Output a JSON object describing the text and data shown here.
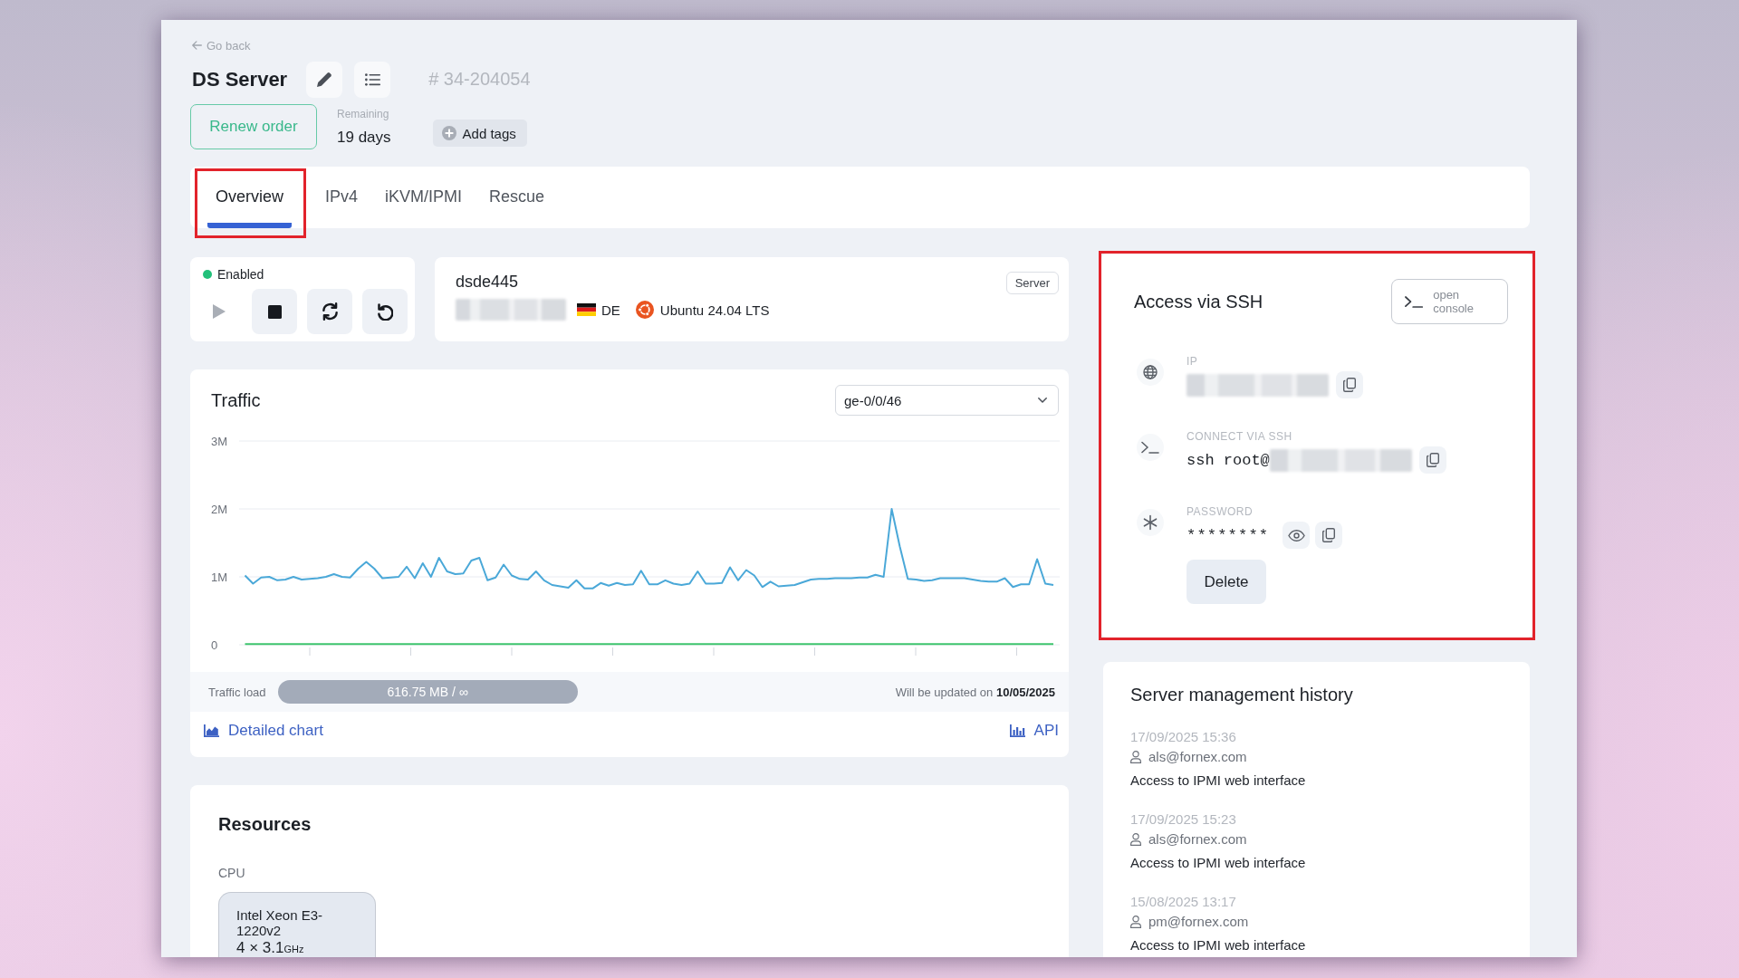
{
  "back_link": "Go back",
  "header": {
    "title": "DS Server",
    "order_number": "# 34-204054"
  },
  "renew_button": "Renew order",
  "remaining": {
    "label": "Remaining",
    "value": "19 days"
  },
  "add_tags_button": "Add tags",
  "tabs": [
    {
      "label": "Overview",
      "selected": true,
      "highlighted": true
    },
    {
      "label": "IPv4",
      "selected": false,
      "highlighted": false
    },
    {
      "label": "iKVM/IPMI",
      "selected": false,
      "highlighted": false
    },
    {
      "label": "Rescue",
      "selected": false,
      "highlighted": false
    }
  ],
  "status": {
    "label": "Enabled",
    "on": true
  },
  "power_buttons": [
    {
      "kind": "start",
      "disabled": true
    },
    {
      "kind": "stop",
      "disabled": false
    },
    {
      "kind": "restart",
      "disabled": false
    },
    {
      "kind": "reset",
      "disabled": false
    }
  ],
  "server_info": {
    "hostname": "dsde445",
    "address_redacted": true,
    "country": "DE",
    "os": "Ubuntu 24.04 LTS",
    "type": "Server"
  },
  "traffic": {
    "title": "Traffic",
    "interface_select": {
      "value": "ge-0/0/46"
    },
    "chart_data": {
      "type": "line",
      "ylim": [
        0,
        3
      ],
      "yticks": [
        {
          "value": 0,
          "label": "0"
        },
        {
          "value": 1,
          "label": "1M"
        },
        {
          "value": 2,
          "label": "2M"
        },
        {
          "value": 3,
          "label": "3M"
        }
      ],
      "series": [
        {
          "color": "#4aa8d8",
          "values": [
            1.02,
            0.9,
            0.99,
            1.0,
            0.95,
            0.96,
            1.0,
            0.96,
            0.97,
            0.98,
            1.0,
            1.04,
            1.0,
            0.99,
            1.12,
            1.22,
            1.12,
            0.98,
            0.99,
            1.0,
            1.15,
            0.98,
            1.2,
            1.0,
            1.28,
            1.08,
            1.04,
            1.05,
            1.24,
            1.28,
            0.95,
            0.99,
            1.18,
            1.02,
            0.97,
            0.96,
            1.08,
            0.95,
            0.88,
            0.86,
            0.84,
            0.95,
            0.83,
            0.83,
            0.91,
            0.87,
            0.91,
            0.88,
            0.89,
            1.09,
            0.89,
            0.89,
            0.95,
            0.9,
            0.88,
            0.9,
            1.08,
            0.9,
            0.9,
            0.91,
            1.14,
            0.95,
            1.1,
            1.02,
            0.85,
            0.93,
            0.86,
            0.87,
            0.88,
            0.92,
            0.96,
            0.97,
            0.97,
            0.98,
            0.98,
            0.98,
            0.99,
            0.99,
            1.03,
            1.0,
            2.0,
            1.45,
            0.97,
            0.96,
            0.94,
            0.95,
            0.98,
            0.98,
            0.98,
            0.98,
            0.96,
            0.94,
            0.93,
            0.93,
            0.98,
            0.85,
            0.89,
            0.89,
            1.26,
            0.9,
            0.88
          ]
        },
        {
          "color": "#3ec46d",
          "values": [
            0.01,
            0.01,
            0.01,
            0.01,
            0.01,
            0.01,
            0.01,
            0.01,
            0.01,
            0.01,
            0.01,
            0.01,
            0.01,
            0.01,
            0.01,
            0.01,
            0.01,
            0.01,
            0.01,
            0.01,
            0.01,
            0.01,
            0.01,
            0.01,
            0.01,
            0.01,
            0.01,
            0.01,
            0.01,
            0.01,
            0.01,
            0.01,
            0.01,
            0.01,
            0.01,
            0.01,
            0.01,
            0.01,
            0.01,
            0.01,
            0.01,
            0.01,
            0.01,
            0.01,
            0.01,
            0.01,
            0.01,
            0.01,
            0.01,
            0.01,
            0.01,
            0.01,
            0.01,
            0.01,
            0.01,
            0.01,
            0.01,
            0.01,
            0.01,
            0.01,
            0.01,
            0.01,
            0.01,
            0.01,
            0.01,
            0.01,
            0.01,
            0.01,
            0.01,
            0.01,
            0.01,
            0.01,
            0.01,
            0.01,
            0.01,
            0.01,
            0.01,
            0.01,
            0.01,
            0.01,
            0.01,
            0.01,
            0.01,
            0.01,
            0.01,
            0.01,
            0.01,
            0.01,
            0.01,
            0.01,
            0.01,
            0.01,
            0.01,
            0.01,
            0.01,
            0.01,
            0.01,
            0.01,
            0.01,
            0.01,
            0.01
          ]
        }
      ]
    },
    "load": {
      "label": "Traffic load",
      "value": "616.75 MB / ∞"
    },
    "update_note": "Will be updated on **10/05/2025**",
    "links": [
      {
        "kind": "chart",
        "label": "Detailed chart"
      },
      {
        "kind": "api",
        "label": "API"
      }
    ]
  },
  "resources": {
    "title": "Resources",
    "cpu": {
      "label": "CPU",
      "model": "Intel Xeon E3-1220v2",
      "frequency": "4 × 3.1",
      "frequency_unit": "GHz"
    }
  },
  "ssh": {
    "title": "Access via SSH",
    "highlighted": true,
    "console_button": "open console",
    "fields": [
      {
        "kind": "ip",
        "label": "IP",
        "redacted": true,
        "actions": [
          {
            "kind": "copy"
          }
        ]
      },
      {
        "kind": "ssh",
        "label": "CONNECT VIA SSH",
        "value": "ssh root@",
        "redacted": true,
        "actions": [
          {
            "kind": "copy"
          }
        ]
      },
      {
        "kind": "password",
        "label": "PASSWORD",
        "value": "********",
        "actions": [
          {
            "kind": "reveal"
          },
          {
            "kind": "copy"
          }
        ]
      }
    ],
    "delete_button": "Delete"
  },
  "history": {
    "title": "Server management history",
    "entries": [
      {
        "date": "17/09/2025 15:36",
        "user": "als@fornex.com",
        "action": "Access to IPMI web interface"
      },
      {
        "date": "17/09/2025 15:23",
        "user": "als@fornex.com",
        "action": "Access to IPMI web interface"
      },
      {
        "date": "15/08/2025 13:17",
        "user": "pm@fornex.com",
        "action": "Access to IPMI web interface"
      }
    ]
  }
}
